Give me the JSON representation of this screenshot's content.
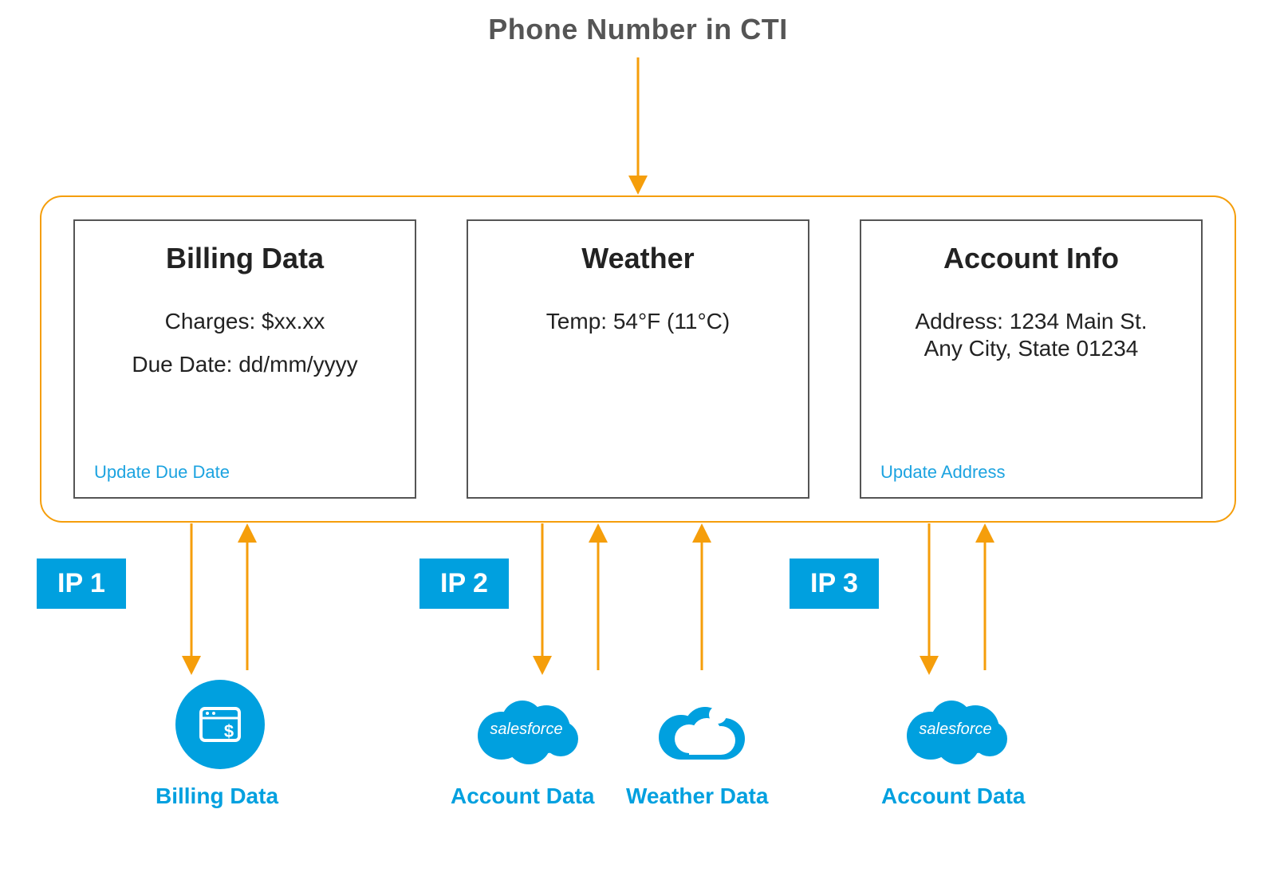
{
  "title": "Phone Number in CTI",
  "cards": {
    "billing": {
      "title": "Billing Data",
      "line1": "Charges: $xx.xx",
      "line2": "Due Date: dd/mm/yyyy",
      "link": "Update Due Date"
    },
    "weather": {
      "title": "Weather",
      "line1": "Temp: 54°F (11°C)"
    },
    "account": {
      "title": "Account Info",
      "line1": "Address: 1234 Main St.",
      "line2": "Any City, State 01234",
      "link": "Update Address"
    }
  },
  "ip_badges": {
    "ip1": "IP 1",
    "ip2": "IP 2",
    "ip3": "IP 3"
  },
  "sources": {
    "billing_data": "Billing Data",
    "account_data_left": "Account Data",
    "weather_data": "Weather Data",
    "account_data_right": "Account Data"
  },
  "icon_text": {
    "salesforce": "salesforce"
  },
  "colors": {
    "accent_orange": "#F59E0B",
    "brand_blue": "#00A0DF",
    "link_blue": "#1CA3E0"
  }
}
